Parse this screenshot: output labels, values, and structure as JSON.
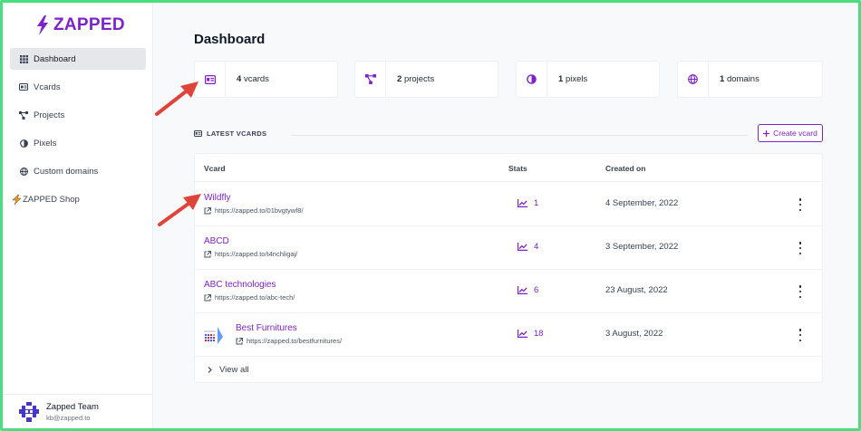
{
  "brand": {
    "name": "ZAPPED"
  },
  "sidebar": {
    "items": [
      {
        "label": "Dashboard",
        "icon": "grid-icon",
        "active": true
      },
      {
        "label": "Vcards",
        "icon": "id-card-icon"
      },
      {
        "label": "Projects",
        "icon": "project-nodes-icon"
      },
      {
        "label": "Pixels",
        "icon": "adjust-icon"
      },
      {
        "label": "Custom domains",
        "icon": "globe-icon"
      },
      {
        "label": "ZAPPED Shop",
        "icon": "bolt-icon"
      }
    ]
  },
  "user": {
    "name": "Zapped Team",
    "email": "kb@zapped.to"
  },
  "page": {
    "title": "Dashboard"
  },
  "stats": [
    {
      "count": "4",
      "label": "vcards",
      "icon": "id-card-icon"
    },
    {
      "count": "2",
      "label": "projects",
      "icon": "project-nodes-icon"
    },
    {
      "count": "1",
      "label": "pixels",
      "icon": "adjust-icon"
    },
    {
      "count": "1",
      "label": "domains",
      "icon": "globe-icon"
    }
  ],
  "latest": {
    "heading": "LATEST VCARDS",
    "create_label": "Create vcard",
    "columns": {
      "vcard": "Vcard",
      "stats": "Stats",
      "created": "Created on"
    },
    "rows": [
      {
        "name": "Wildfly",
        "url": "https://zapped.to/01bvgtywf8/",
        "stats": "1",
        "created": "4 September, 2022"
      },
      {
        "name": "ABCD",
        "url": "https://zapped.to/t4nchligaj/",
        "stats": "4",
        "created": "3 September, 2022"
      },
      {
        "name": "ABC technologies",
        "url": "https://zapped.to/abc-tech/",
        "stats": "6",
        "created": "23 August, 2022"
      },
      {
        "name": "Best Furnitures",
        "url": "https://zapped.to/bestfurnitures/",
        "stats": "18",
        "created": "3 August, 2022"
      }
    ],
    "view_all": "View all"
  },
  "colors": {
    "accent": "#7e22ce",
    "annotation_arrow": "#e0433a",
    "frame": "#4ade80"
  }
}
